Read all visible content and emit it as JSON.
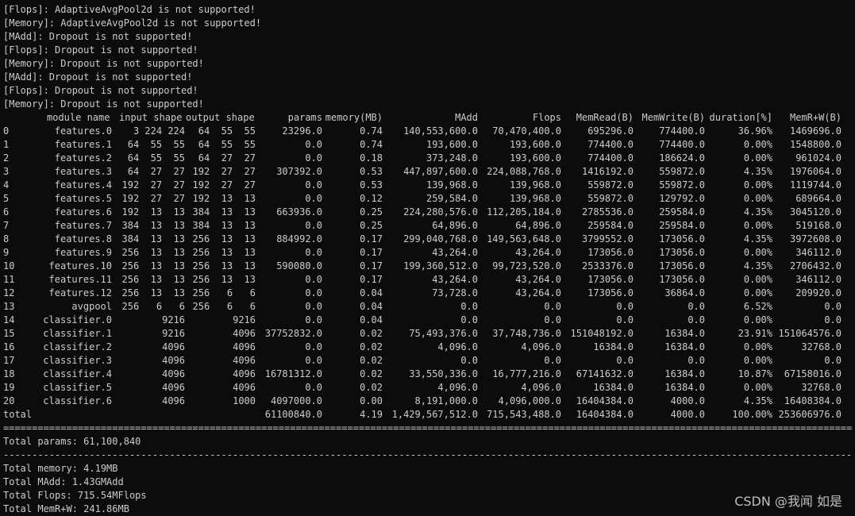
{
  "warnings": [
    "[Flops]: AdaptiveAvgPool2d is not supported!",
    "[Memory]: AdaptiveAvgPool2d is not supported!",
    "[MAdd]: Dropout is not supported!",
    "[Flops]: Dropout is not supported!",
    "[Memory]: Dropout is not supported!",
    "[MAdd]: Dropout is not supported!",
    "[Flops]: Dropout is not supported!",
    "[Memory]: Dropout is not supported!"
  ],
  "table": {
    "headers": {
      "module_name": "module name",
      "input_shape": "input shape",
      "output_shape": "output shape",
      "params": "params",
      "memory": "memory(MB)",
      "madd": "MAdd",
      "flops": "Flops",
      "memread": "MemRead(B)",
      "memwrite": "MemWrite(B)",
      "duration": "duration[%]",
      "memrw": "MemR+W(B)"
    },
    "rows": [
      {
        "idx": "0",
        "name": "features.0",
        "inp": "3 224 224",
        "out": "64  55  55",
        "params": "23296.0",
        "mem": "0.74",
        "madd": "140,553,600.0",
        "flops": "70,470,400.0",
        "mr": "695296.0",
        "mw": "774400.0",
        "dur": "36.96%",
        "mrw": "1469696.0"
      },
      {
        "idx": "1",
        "name": "features.1",
        "inp": "64  55  55",
        "out": "64  55  55",
        "params": "0.0",
        "mem": "0.74",
        "madd": "193,600.0",
        "flops": "193,600.0",
        "mr": "774400.0",
        "mw": "774400.0",
        "dur": "0.00%",
        "mrw": "1548800.0"
      },
      {
        "idx": "2",
        "name": "features.2",
        "inp": "64  55  55",
        "out": "64  27  27",
        "params": "0.0",
        "mem": "0.18",
        "madd": "373,248.0",
        "flops": "193,600.0",
        "mr": "774400.0",
        "mw": "186624.0",
        "dur": "0.00%",
        "mrw": "961024.0"
      },
      {
        "idx": "3",
        "name": "features.3",
        "inp": "64  27  27",
        "out": "192  27  27",
        "params": "307392.0",
        "mem": "0.53",
        "madd": "447,897,600.0",
        "flops": "224,088,768.0",
        "mr": "1416192.0",
        "mw": "559872.0",
        "dur": "4.35%",
        "mrw": "1976064.0"
      },
      {
        "idx": "4",
        "name": "features.4",
        "inp": "192  27  27",
        "out": "192  27  27",
        "params": "0.0",
        "mem": "0.53",
        "madd": "139,968.0",
        "flops": "139,968.0",
        "mr": "559872.0",
        "mw": "559872.0",
        "dur": "0.00%",
        "mrw": "1119744.0"
      },
      {
        "idx": "5",
        "name": "features.5",
        "inp": "192  27  27",
        "out": "192  13  13",
        "params": "0.0",
        "mem": "0.12",
        "madd": "259,584.0",
        "flops": "139,968.0",
        "mr": "559872.0",
        "mw": "129792.0",
        "dur": "0.00%",
        "mrw": "689664.0"
      },
      {
        "idx": "6",
        "name": "features.6",
        "inp": "192  13  13",
        "out": "384  13  13",
        "params": "663936.0",
        "mem": "0.25",
        "madd": "224,280,576.0",
        "flops": "112,205,184.0",
        "mr": "2785536.0",
        "mw": "259584.0",
        "dur": "4.35%",
        "mrw": "3045120.0"
      },
      {
        "idx": "7",
        "name": "features.7",
        "inp": "384  13  13",
        "out": "384  13  13",
        "params": "0.0",
        "mem": "0.25",
        "madd": "64,896.0",
        "flops": "64,896.0",
        "mr": "259584.0",
        "mw": "259584.0",
        "dur": "0.00%",
        "mrw": "519168.0"
      },
      {
        "idx": "8",
        "name": "features.8",
        "inp": "384  13  13",
        "out": "256  13  13",
        "params": "884992.0",
        "mem": "0.17",
        "madd": "299,040,768.0",
        "flops": "149,563,648.0",
        "mr": "3799552.0",
        "mw": "173056.0",
        "dur": "4.35%",
        "mrw": "3972608.0"
      },
      {
        "idx": "9",
        "name": "features.9",
        "inp": "256  13  13",
        "out": "256  13  13",
        "params": "0.0",
        "mem": "0.17",
        "madd": "43,264.0",
        "flops": "43,264.0",
        "mr": "173056.0",
        "mw": "173056.0",
        "dur": "0.00%",
        "mrw": "346112.0"
      },
      {
        "idx": "10",
        "name": "features.10",
        "inp": "256  13  13",
        "out": "256  13  13",
        "params": "590080.0",
        "mem": "0.17",
        "madd": "199,360,512.0",
        "flops": "99,723,520.0",
        "mr": "2533376.0",
        "mw": "173056.0",
        "dur": "4.35%",
        "mrw": "2706432.0"
      },
      {
        "idx": "11",
        "name": "features.11",
        "inp": "256  13  13",
        "out": "256  13  13",
        "params": "0.0",
        "mem": "0.17",
        "madd": "43,264.0",
        "flops": "43,264.0",
        "mr": "173056.0",
        "mw": "173056.0",
        "dur": "0.00%",
        "mrw": "346112.0"
      },
      {
        "idx": "12",
        "name": "features.12",
        "inp": "256  13  13",
        "out": "256   6   6",
        "params": "0.0",
        "mem": "0.04",
        "madd": "73,728.0",
        "flops": "43,264.0",
        "mr": "173056.0",
        "mw": "36864.0",
        "dur": "0.00%",
        "mrw": "209920.0"
      },
      {
        "idx": "13",
        "name": "avgpool",
        "inp": "256   6   6",
        "out": "256   6   6",
        "params": "0.0",
        "mem": "0.04",
        "madd": "0.0",
        "flops": "0.0",
        "mr": "0.0",
        "mw": "0.0",
        "dur": "6.52%",
        "mrw": "0.0"
      },
      {
        "idx": "14",
        "name": "classifier.0",
        "inp": "9216",
        "out": "9216",
        "params": "0.0",
        "mem": "0.04",
        "madd": "0.0",
        "flops": "0.0",
        "mr": "0.0",
        "mw": "0.0",
        "dur": "0.00%",
        "mrw": "0.0"
      },
      {
        "idx": "15",
        "name": "classifier.1",
        "inp": "9216",
        "out": "4096",
        "params": "37752832.0",
        "mem": "0.02",
        "madd": "75,493,376.0",
        "flops": "37,748,736.0",
        "mr": "151048192.0",
        "mw": "16384.0",
        "dur": "23.91%",
        "mrw": "151064576.0"
      },
      {
        "idx": "16",
        "name": "classifier.2",
        "inp": "4096",
        "out": "4096",
        "params": "0.0",
        "mem": "0.02",
        "madd": "4,096.0",
        "flops": "4,096.0",
        "mr": "16384.0",
        "mw": "16384.0",
        "dur": "0.00%",
        "mrw": "32768.0"
      },
      {
        "idx": "17",
        "name": "classifier.3",
        "inp": "4096",
        "out": "4096",
        "params": "0.0",
        "mem": "0.02",
        "madd": "0.0",
        "flops": "0.0",
        "mr": "0.0",
        "mw": "0.0",
        "dur": "0.00%",
        "mrw": "0.0"
      },
      {
        "idx": "18",
        "name": "classifier.4",
        "inp": "4096",
        "out": "4096",
        "params": "16781312.0",
        "mem": "0.02",
        "madd": "33,550,336.0",
        "flops": "16,777,216.0",
        "mr": "67141632.0",
        "mw": "16384.0",
        "dur": "10.87%",
        "mrw": "67158016.0"
      },
      {
        "idx": "19",
        "name": "classifier.5",
        "inp": "4096",
        "out": "4096",
        "params": "0.0",
        "mem": "0.02",
        "madd": "4,096.0",
        "flops": "4,096.0",
        "mr": "16384.0",
        "mw": "16384.0",
        "dur": "0.00%",
        "mrw": "32768.0"
      },
      {
        "idx": "20",
        "name": "classifier.6",
        "inp": "4096",
        "out": "1000",
        "params": "4097000.0",
        "mem": "0.00",
        "madd": "8,191,000.0",
        "flops": "4,096,000.0",
        "mr": "16404384.0",
        "mw": "4000.0",
        "dur": "4.35%",
        "mrw": "16408384.0"
      },
      {
        "idx": "total",
        "name": "",
        "inp": "",
        "out": "",
        "params": "61100840.0",
        "mem": "4.19",
        "madd": "1,429,567,512.0",
        "flops": "715,543,488.0",
        "mr": "16404384.0",
        "mw": "4000.0",
        "dur": "100.00%",
        "mrw": "253606976.0"
      }
    ]
  },
  "summary": {
    "total_params": "Total params: 61,100,840",
    "total_memory": "Total memory: 4.19MB",
    "total_madd": "Total MAdd: 1.43GMAdd",
    "total_flops": "Total Flops: 715.54MFlops",
    "total_memrw": "Total MemR+W: 241.86MB"
  },
  "watermark": "CSDN @我闻 如是"
}
